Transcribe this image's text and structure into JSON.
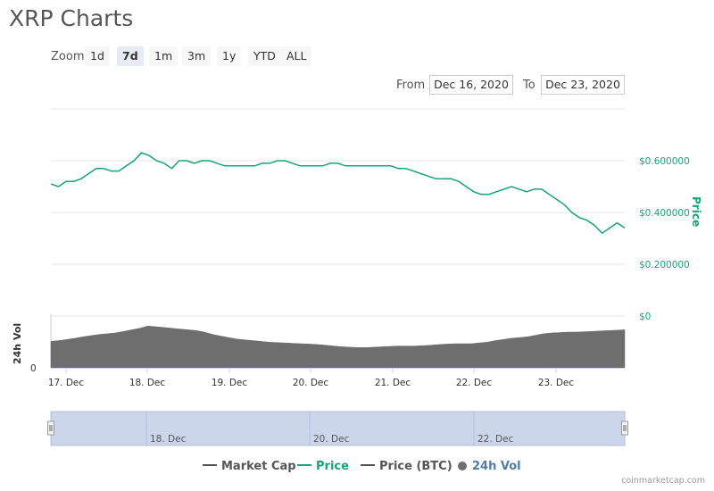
{
  "header": {
    "title": "XRP Charts"
  },
  "zoom": {
    "label": "Zoom",
    "buttons": [
      "1d",
      "7d",
      "1m",
      "3m",
      "1y",
      "YTD",
      "ALL"
    ],
    "active": "7d"
  },
  "range": {
    "from_label": "From",
    "from_value": "Dec 16, 2020",
    "to_label": "To",
    "to_value": "Dec 23, 2020"
  },
  "colors": {
    "price": "#16a37d",
    "volume": "#6e6e6e",
    "grid": "#e6e6e6",
    "navigator_fill": "#ccd6eb",
    "legend_market_cap": "#555555",
    "legend_price_btc": "#555555"
  },
  "legend": [
    {
      "label": "Market Cap",
      "color": "#555555",
      "marker": "line"
    },
    {
      "label": "Price",
      "color": "#16a37d",
      "marker": "line"
    },
    {
      "label": "Price (BTC)",
      "color": "#555555",
      "marker": "line"
    },
    {
      "label": "24h Vol",
      "color": "#4f7ca8",
      "marker": "circle"
    }
  ],
  "credits": "coinmarketcap.com",
  "chart_data": {
    "type": "line",
    "title": "",
    "y_axis_right_title": "Price",
    "y_axis_left_title": "24h Vol",
    "y_ticks": [
      "$0.600000",
      "$0.400000",
      "$0.200000",
      "$0"
    ],
    "y_tick_values": [
      0.6,
      0.4,
      0.2,
      0
    ],
    "ylim": [
      0,
      0.8
    ],
    "vol_tick": "0",
    "x_tick_labels": [
      "17. Dec",
      "18. Dec",
      "19. Dec",
      "20. Dec",
      "21. Dec",
      "22. Dec",
      "23. Dec"
    ],
    "navigator_labels": [
      "18. Dec",
      "20. Dec",
      "22. Dec"
    ],
    "x_start": "Dec 16, 2020 16:00",
    "x_end": "Dec 23, 2020 19:00",
    "grid": true,
    "series": [
      {
        "name": "Price",
        "unit": "USD",
        "values": [
          0.51,
          0.5,
          0.52,
          0.52,
          0.53,
          0.55,
          0.57,
          0.57,
          0.56,
          0.56,
          0.58,
          0.6,
          0.63,
          0.62,
          0.6,
          0.59,
          0.57,
          0.6,
          0.6,
          0.59,
          0.6,
          0.6,
          0.59,
          0.58,
          0.58,
          0.58,
          0.58,
          0.58,
          0.59,
          0.59,
          0.6,
          0.6,
          0.59,
          0.58,
          0.58,
          0.58,
          0.58,
          0.59,
          0.59,
          0.58,
          0.58,
          0.58,
          0.58,
          0.58,
          0.58,
          0.58,
          0.57,
          0.57,
          0.56,
          0.55,
          0.54,
          0.53,
          0.53,
          0.53,
          0.52,
          0.5,
          0.48,
          0.47,
          0.47,
          0.48,
          0.49,
          0.5,
          0.49,
          0.48,
          0.49,
          0.49,
          0.47,
          0.45,
          0.43,
          0.4,
          0.38,
          0.37,
          0.35,
          0.32,
          0.34,
          0.36,
          0.34
        ]
      },
      {
        "name": "24h Vol",
        "unit": "relative",
        "values": [
          0.5,
          0.52,
          0.55,
          0.58,
          0.62,
          0.65,
          0.68,
          0.7,
          0.72,
          0.76,
          0.8,
          0.84,
          0.9,
          0.88,
          0.86,
          0.84,
          0.82,
          0.8,
          0.78,
          0.74,
          0.68,
          0.64,
          0.6,
          0.56,
          0.54,
          0.52,
          0.5,
          0.48,
          0.47,
          0.46,
          0.45,
          0.44,
          0.43,
          0.42,
          0.4,
          0.38,
          0.36,
          0.35,
          0.34,
          0.34,
          0.35,
          0.36,
          0.37,
          0.38,
          0.38,
          0.38,
          0.39,
          0.4,
          0.42,
          0.43,
          0.44,
          0.44,
          0.44,
          0.46,
          0.48,
          0.52,
          0.55,
          0.58,
          0.6,
          0.62,
          0.66,
          0.7,
          0.72,
          0.73,
          0.74,
          0.74,
          0.75,
          0.76,
          0.77,
          0.78,
          0.79,
          0.8
        ]
      }
    ]
  }
}
